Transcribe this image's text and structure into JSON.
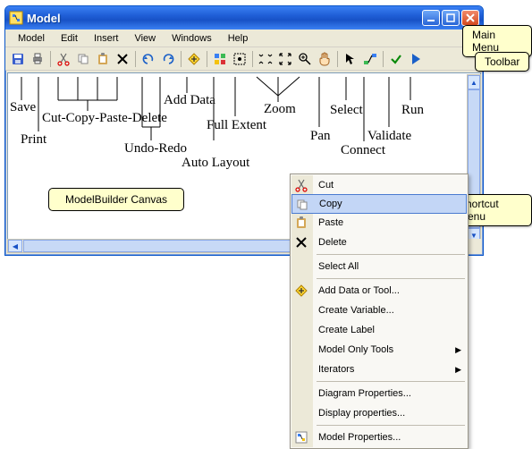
{
  "window": {
    "title": "Model"
  },
  "menubar": [
    "Model",
    "Edit",
    "Insert",
    "View",
    "Windows",
    "Help"
  ],
  "toolbar_icons": [
    "save-icon",
    "print-icon",
    "cut-icon",
    "copy-icon",
    "paste-icon",
    "delete-icon",
    "undo-icon",
    "redo-icon",
    "add-data-icon",
    "auto-layout-icon",
    "full-extent-icon",
    "zoom-in-area-icon",
    "zoom-out-area-icon",
    "zoom-in-icon",
    "pan-icon",
    "select-icon",
    "connect-icon",
    "validate-icon",
    "run-icon"
  ],
  "diagram_labels": {
    "save": "Save",
    "print": "Print",
    "ccpd": "Cut-Copy-Paste-Delete",
    "undoredo": "Undo-Redo",
    "adddata": "Add Data",
    "autolayout": "Auto Layout",
    "fullextent": "Full Extent",
    "zoom": "Zoom",
    "pan": "Pan",
    "select": "Select",
    "connect": "Connect",
    "validate": "Validate",
    "run": "Run"
  },
  "callouts": {
    "mainmenu": "Main Menu",
    "toolbar": "Toolbar",
    "canvas": "ModelBuilder Canvas",
    "shortcut": "Shortcut Menu"
  },
  "context_menu": {
    "items": [
      {
        "label": "Cut",
        "icon": "cut-icon"
      },
      {
        "label": "Copy",
        "icon": "copy-icon",
        "highlighted": true
      },
      {
        "label": "Paste",
        "icon": "paste-icon"
      },
      {
        "label": "Delete",
        "icon": "delete-icon"
      },
      {
        "sep": true
      },
      {
        "label": "Select All"
      },
      {
        "sep": true
      },
      {
        "label": "Add Data or Tool...",
        "icon": "add-data-icon"
      },
      {
        "label": "Create Variable..."
      },
      {
        "label": "Create Label"
      },
      {
        "label": "Model Only Tools",
        "submenu": true
      },
      {
        "label": "Iterators",
        "submenu": true
      },
      {
        "sep": true
      },
      {
        "label": "Diagram Properties..."
      },
      {
        "label": "Display properties..."
      },
      {
        "sep": true
      },
      {
        "label": "Model Properties...",
        "icon": "model-properties-icon"
      }
    ]
  }
}
